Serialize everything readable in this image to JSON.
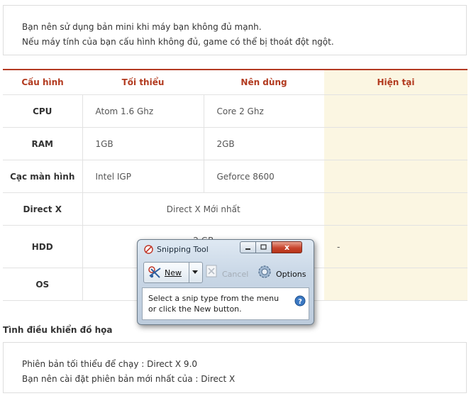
{
  "notice": {
    "line1": "Bạn nên sử dụng bản mini khi máy bạn không đủ mạnh.",
    "line2": "Nếu máy tính của bạn cấu hình không đủ, game có thể bị thoát đột ngột."
  },
  "spec_table": {
    "headers": [
      "Cấu hình",
      "Tối thiểu",
      "Nên dùng",
      "Hiện tại"
    ],
    "rows": [
      {
        "label": "CPU",
        "min": "Atom 1.6 Ghz",
        "rec": "Core 2 Ghz",
        "cur": ""
      },
      {
        "label": "RAM",
        "min": "1GB",
        "rec": "2GB",
        "cur": ""
      },
      {
        "label": "Cạc màn hình",
        "min": "Intel IGP",
        "rec": "Geforce 8600",
        "cur": ""
      },
      {
        "label": "Direct X",
        "merged": "Direct X Mới nhất",
        "cur": ""
      },
      {
        "label": "HDD",
        "merged": "2 GB",
        "cur": "-"
      },
      {
        "label": "OS",
        "merged": "",
        "cur": ""
      }
    ]
  },
  "driver_section": {
    "title": "Tình điều khiển đồ họa",
    "line1": "Phiên bản tối thiểu để chạy : Direct X 9.0",
    "line2": "Bạn nên cài đặt phiên bản mới nhất của : Direct X"
  },
  "snipping_tool": {
    "title": "Snipping Tool",
    "new_label": "New",
    "cancel_label": "Cancel",
    "options_label": "Options",
    "message": "Select a snip type from the menu or click the New button.",
    "close_glyph": "x",
    "icons": [
      "scissors-icon",
      "dropdown-arrow-icon",
      "cancel-icon",
      "options-gear-icon",
      "help-icon"
    ]
  },
  "colors": {
    "accent": "#b43a22",
    "current_column_bg": "#fbf6e2",
    "border": "#dddddd"
  }
}
